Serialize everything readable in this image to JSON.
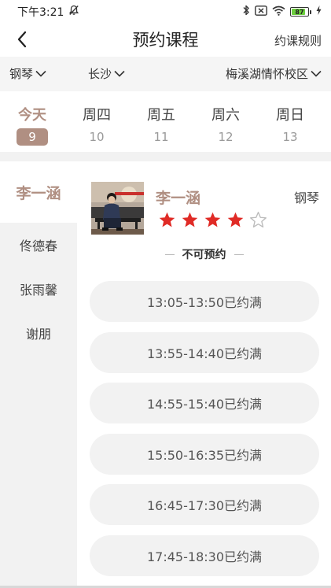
{
  "status_bar": {
    "time": "下午3:21",
    "battery_level": "87",
    "battery_fill": 0.87
  },
  "header": {
    "title": "预约课程",
    "rules_link": "约课规则"
  },
  "filters": {
    "instrument": "钢琴",
    "city": "长沙",
    "campus": "梅溪湖情怀校区"
  },
  "dates": [
    {
      "label": "今天",
      "day": "9",
      "active": true
    },
    {
      "label": "周四",
      "day": "10",
      "active": false
    },
    {
      "label": "周五",
      "day": "11",
      "active": false
    },
    {
      "label": "周六",
      "day": "12",
      "active": false
    },
    {
      "label": "周日",
      "day": "13",
      "active": false
    }
  ],
  "teachers": [
    {
      "name": "李一涵",
      "active": true
    },
    {
      "name": "佟德春",
      "active": false
    },
    {
      "name": "张雨馨",
      "active": false
    },
    {
      "name": "谢朋",
      "active": false
    }
  ],
  "teacher_detail": {
    "name": "李一涵",
    "instrument": "钢琴",
    "rating": 4,
    "rating_max": 5,
    "booking_status": "不可预约"
  },
  "time_slots": [
    "13:05-13:50已约满",
    "13:55-14:40已约满",
    "14:55-15:40已约满",
    "15:50-16:35已约满",
    "16:45-17:30已约满",
    "17:45-18:30已约满"
  ],
  "colors": {
    "accent": "#b08f82",
    "star_filled": "#e02b26",
    "star_empty": "#bbbbbb",
    "slot_bg": "#f2f2f2"
  }
}
